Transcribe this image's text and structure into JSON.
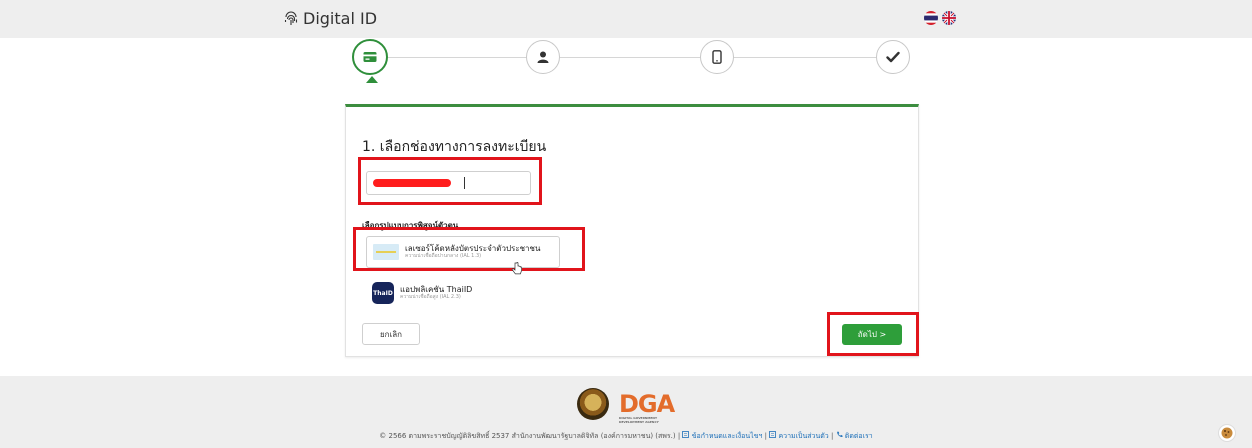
{
  "header": {
    "brand": "Digital ID",
    "languages": [
      "th",
      "en"
    ]
  },
  "stepper": {
    "active_index": 0,
    "steps": [
      {
        "icon": "id-card-icon"
      },
      {
        "icon": "user-icon"
      },
      {
        "icon": "mobile-icon"
      },
      {
        "icon": "check-icon"
      }
    ]
  },
  "form": {
    "title": "1. เลือกช่องทางการลงทะเบียน",
    "channel_value": "",
    "method_label": "เลือกรูปแบบการพิสูจน์ตัวตน",
    "methods": [
      {
        "name": "เลเซอร์โค้ดหลังบัตรประจำตัวประชาชน",
        "level": "ความน่าเชื่อถือปานกลาง (IAL 1.3)",
        "icon": "id-card-icon"
      },
      {
        "name": "แอปพลิเคชัน ThaiID",
        "level": "ความน่าเชื่อถือสูง (IAL 2.3)",
        "icon": "thaid-app-icon",
        "icon_text": "ThaID"
      }
    ],
    "cancel_label": "ยกเลิก",
    "next_label": "ถัดไป >"
  },
  "footer": {
    "copyright": "© 2566 ตามพระราชบัญญัติลิขสิทธิ์ 2537 สำนักงานพัฒนารัฐบาลดิจิทัล (องค์การมหาชน) (สพร.) |",
    "link_terms": "ข้อกำหนดและเงื่อนไขฯ",
    "link_privacy": "ความเป็นส่วนตัว",
    "link_contact": "ติดต่อเรา",
    "separator": "|",
    "dga_logo_text": "DGA",
    "dga_logo_sub": "DIGITAL GOVERNMENT DEVELOPMENT AGENCY"
  },
  "colors": {
    "accent_green": "#2e9e3a",
    "highlight_red": "#e1141b",
    "redaction": "#ff1d1d"
  }
}
